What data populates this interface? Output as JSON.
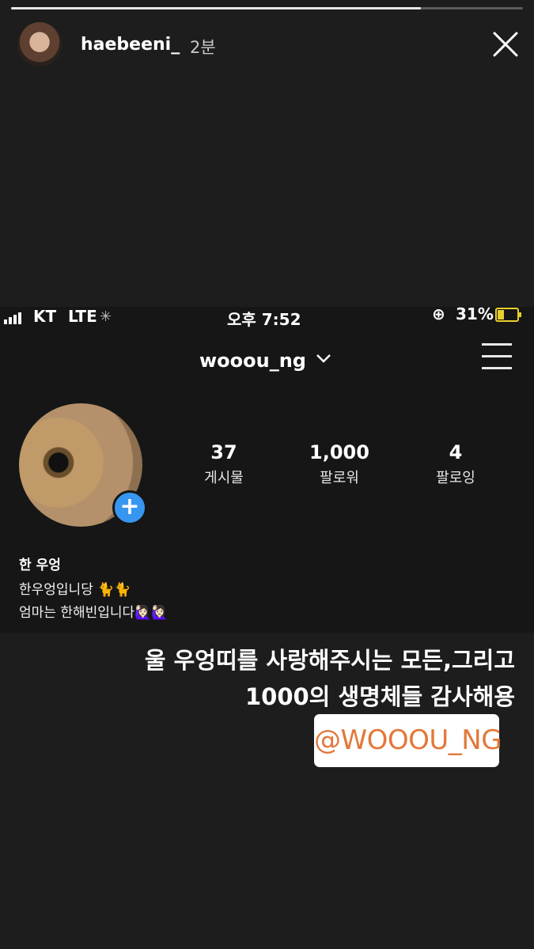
{
  "story": {
    "progress": 0.8,
    "username": "haebeeni_",
    "time": "2분"
  },
  "screenshot": {
    "status_bar": {
      "carrier": "KT",
      "network": "LTE",
      "time": "오후 7:52",
      "battery": "31%"
    },
    "profile": {
      "handle": "wooou_ng",
      "posts": {
        "count": "37",
        "label": "게시물"
      },
      "followers": {
        "count": "1,000",
        "label": "팔로워"
      },
      "following": {
        "count": "4",
        "label": "팔로잉"
      },
      "name": "한 우엉",
      "bio": [
        "한우엉입니당 🐈🐈",
        "엄마는 한해빈입니다🙋🏻‍♀️🙋🏻‍♀️"
      ]
    }
  },
  "caption": {
    "line1": "울 우엉띠를 사랑해주시는 모든,그리고",
    "line2": "1000의 생명체들 감사해용"
  },
  "mention": "@WOOOU_NG",
  "colors": {
    "accent_blue": "#3797f0",
    "mention_orange": "#e2783a",
    "battery_yellow": "#e7d02b"
  }
}
